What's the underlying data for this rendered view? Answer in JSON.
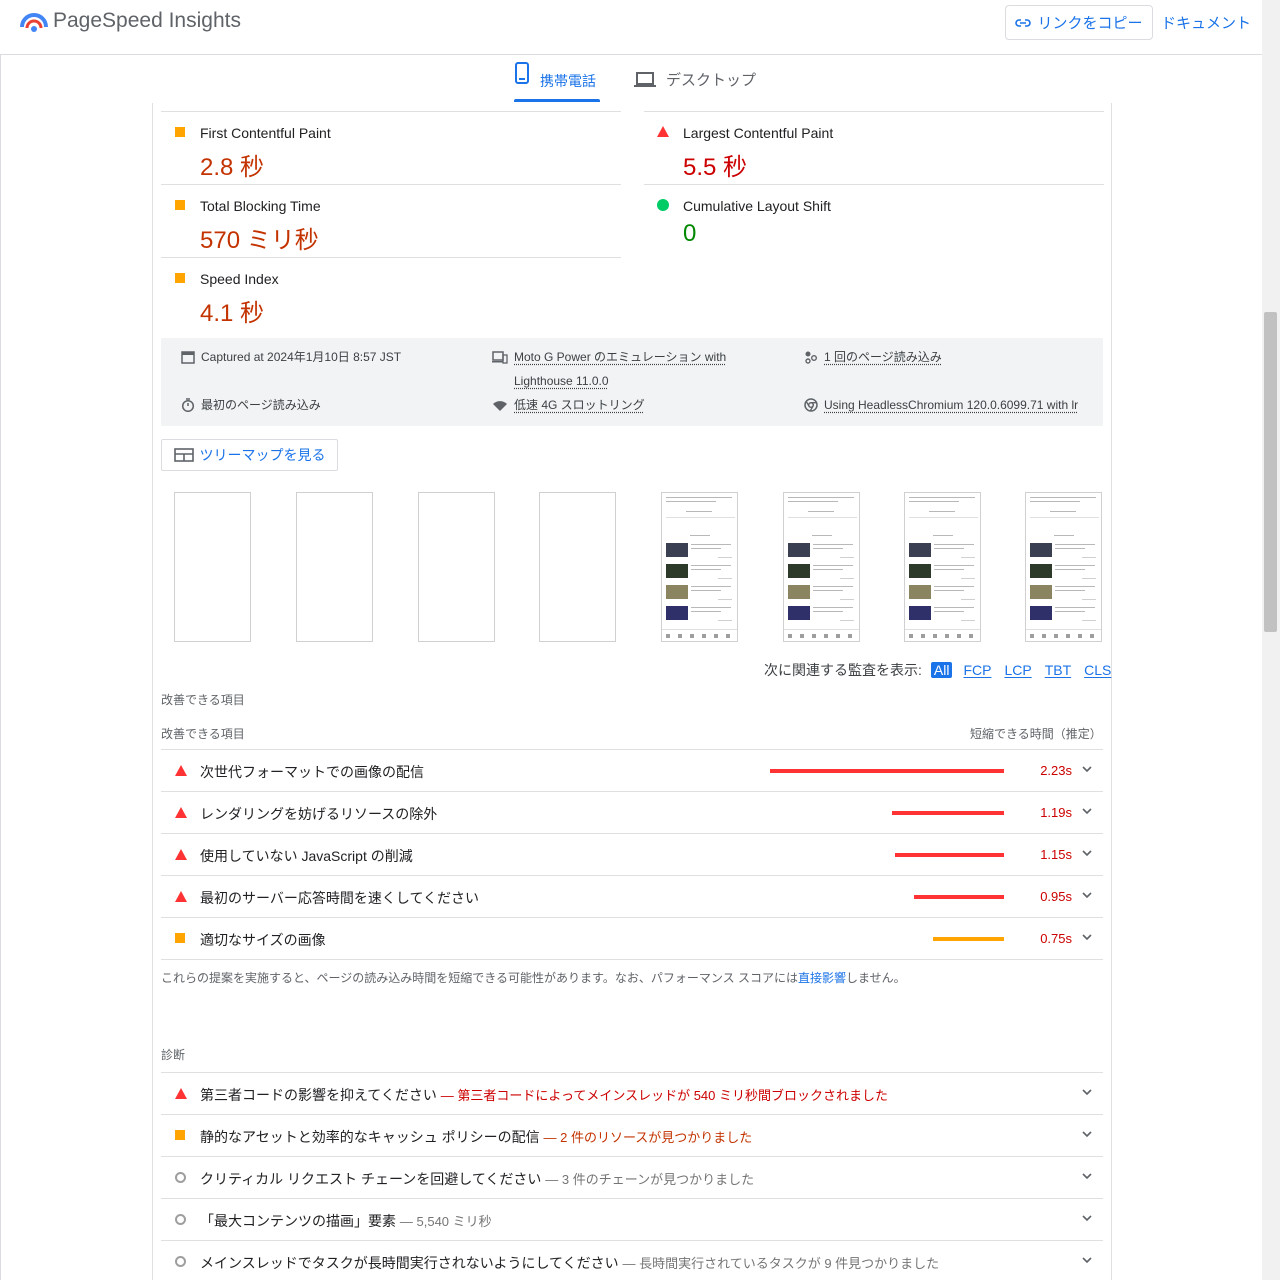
{
  "header": {
    "app_title": "PageSpeed Insights",
    "copy_link_label": "リンクをコピー",
    "docs_label": "ドキュメント"
  },
  "tabs": {
    "mobile_label": "携帯電話",
    "desktop_label": "デスクトップ",
    "active": "mobile"
  },
  "metrics": [
    {
      "label": "First Contentful Paint",
      "value": "2.8 秒",
      "status": "average"
    },
    {
      "label": "Largest Contentful Paint",
      "value": "5.5 秒",
      "status": "fail"
    },
    {
      "label": "Total Blocking Time",
      "value": "570 ミリ秒",
      "status": "average"
    },
    {
      "label": "Cumulative Layout Shift",
      "value": "0",
      "status": "pass"
    },
    {
      "label": "Speed Index",
      "value": "4.1 秒",
      "status": "average"
    }
  ],
  "info": {
    "captured": "Captured at 2024年1月10日 8:57 JST",
    "first_load": "最初のページ読み込み",
    "device": "Moto G Power のエミュレーション with",
    "lighthouse": "Lighthouse 11.0.0",
    "throttling": "低速 4G スロットリング",
    "page_loads": "1 回のページ読み込み",
    "browser": "Using HeadlessChromium 120.0.6099.71 with lr"
  },
  "treemap_label": "ツリーマップを見る",
  "filter": {
    "prompt": "次に関連する監査を表示:",
    "options": [
      "All",
      "FCP",
      "LCP",
      "TBT",
      "CLS"
    ],
    "active": "All"
  },
  "opportunities": {
    "section_title": "改善できる項目",
    "table_header": "改善できる項目",
    "savings_header": "短縮できる時間（推定）",
    "items": [
      {
        "title": "次世代フォーマットでの画像の配信",
        "savings": "2.23s",
        "savings_seconds": 2.23,
        "status": "fail"
      },
      {
        "title": "レンダリングを妨げるリソースの除外",
        "savings": "1.19s",
        "savings_seconds": 1.19,
        "status": "fail"
      },
      {
        "title": "使用していない JavaScript の削減",
        "savings": "1.15s",
        "savings_seconds": 1.15,
        "status": "fail"
      },
      {
        "title": "最初のサーバー応答時間を速くしてください",
        "savings": "0.95s",
        "savings_seconds": 0.95,
        "status": "fail"
      },
      {
        "title": "適切なサイズの画像",
        "savings": "0.75s",
        "savings_seconds": 0.75,
        "status": "average"
      }
    ],
    "note_before": "これらの提案を実施すると、ページの読み込み時間を短縮できる可能性があります。なお、パフォーマンス スコアには",
    "note_link": "直接影響",
    "note_after": "しません。"
  },
  "diagnostics": {
    "section_title": "診断",
    "items": [
      {
        "title": "第三者コードの影響を抑えてください",
        "detail": "— 第三者コードによってメインスレッドが 540 ミリ秒間ブロックされました",
        "status": "fail"
      },
      {
        "title": "静的なアセットと効率的なキャッシュ ポリシーの配信",
        "detail": "— 2 件のリソースが見つかりました",
        "status": "average"
      },
      {
        "title": "クリティカル リクエスト チェーンを回避してください",
        "detail": "— 3 件のチェーンが見つかりました",
        "status": "info"
      },
      {
        "title": "「最大コンテンツの描画」要素",
        "detail": "— 5,540 ミリ秒",
        "status": "info"
      },
      {
        "title": "メインスレッドでタスクが長時間実行されないようにしてください",
        "detail": "— 長時間実行されているタスクが 9 件見つかりました",
        "status": "info"
      }
    ]
  },
  "colors": {
    "accent": "#1a73e8",
    "fail": "#ff3333",
    "average": "#ffa400",
    "pass": "#00cc66"
  }
}
